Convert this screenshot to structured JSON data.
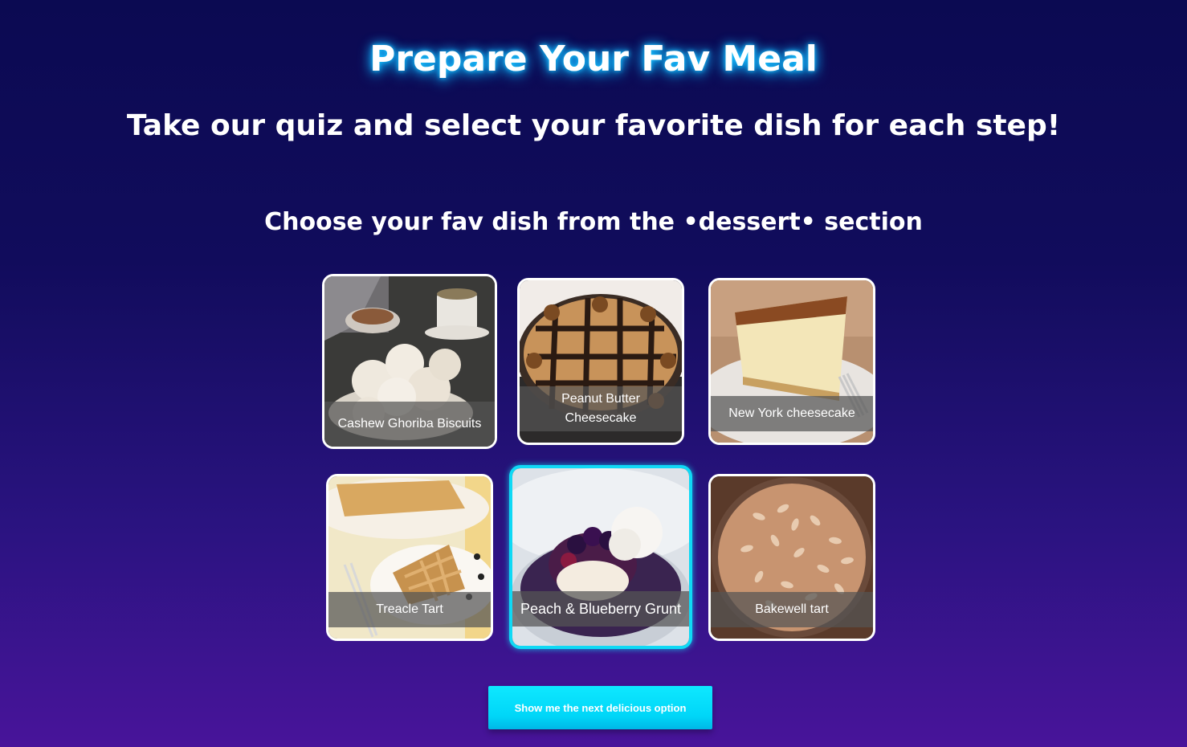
{
  "header": {
    "title": "Prepare Your Fav Meal",
    "subtitle": "Take our quiz and select your favorite dish for each step!"
  },
  "quiz": {
    "section_prompt": "Choose your fav dish from the •dessert• section",
    "selected_index": 4,
    "options": [
      {
        "label": "Cashew Ghoriba Biscuits",
        "image": "cashew-biscuits-photo"
      },
      {
        "label": "Peanut Butter Cheesecake",
        "image": "peanut-butter-cheesecake-photo"
      },
      {
        "label": "New York cheesecake",
        "image": "new-york-cheesecake-photo"
      },
      {
        "label": "Treacle Tart",
        "image": "treacle-tart-photo"
      },
      {
        "label": "Peach & Blueberry Grunt",
        "image": "peach-blueberry-grunt-photo"
      },
      {
        "label": "Bakewell tart",
        "image": "bakewell-tart-photo"
      }
    ]
  },
  "actions": {
    "next_label": "Show me the next delicious option"
  },
  "colors": {
    "background_top": "#0b0a52",
    "background_bottom": "#48149a",
    "accent": "#0fd9f5",
    "title_glow": "#18c8ff"
  }
}
